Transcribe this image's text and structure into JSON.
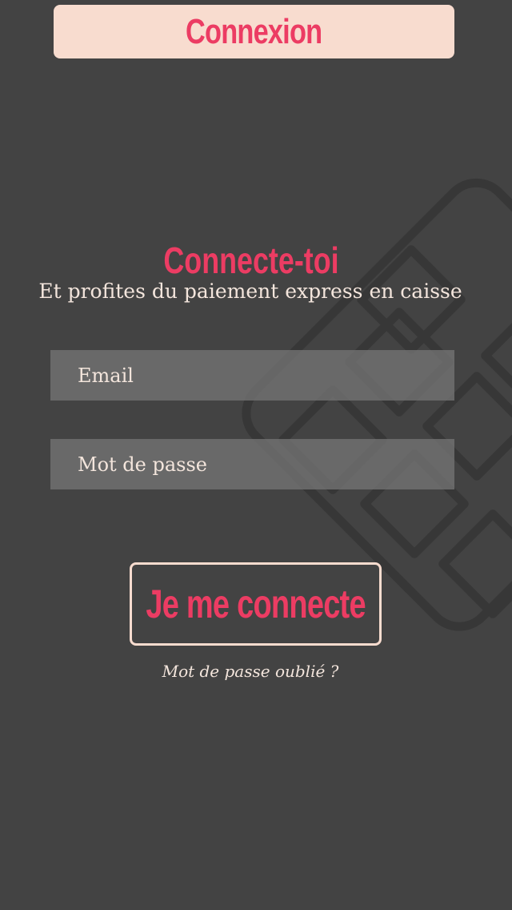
{
  "header": {
    "title": "Connexion"
  },
  "main": {
    "heading": "Connecte-toi",
    "subheading": "Et profites du paiement express en caisse"
  },
  "form": {
    "email_placeholder": "Email",
    "email_value": "",
    "password_placeholder": "Mot de passe",
    "password_value": "",
    "submit_label": "Je me connecte",
    "forgot_password_label": "Mot de passe oublié ?"
  },
  "colors": {
    "background": "#434343",
    "accent": "#ec3c63",
    "header_background": "#f8dccf",
    "text_light": "#f3e5dc",
    "field_background": "#787878"
  },
  "icons": {
    "background_decoration": "keypad-grid-icon"
  }
}
